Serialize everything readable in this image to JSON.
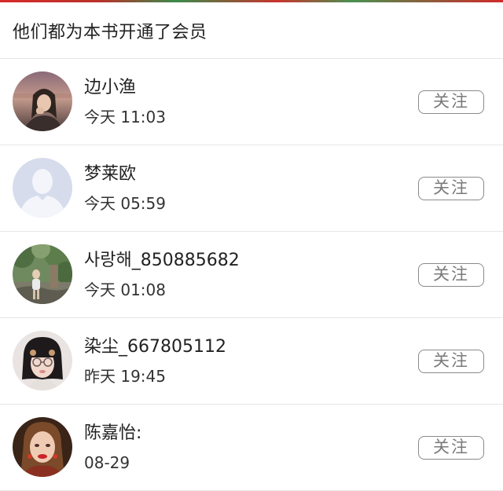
{
  "header": {
    "title": "他们都为本书开通了会员"
  },
  "members": [
    {
      "name": "边小渔",
      "time": "今天 11:03",
      "follow_label": "关注",
      "avatar_icon": "user-photo-avatar"
    },
    {
      "name": "梦莱欧",
      "time": "今天 05:59",
      "follow_label": "关注",
      "avatar_icon": "default-user-avatar"
    },
    {
      "name": "사랑해_850885682",
      "time": "今天 01:08",
      "follow_label": "关注",
      "avatar_icon": "user-photo-avatar"
    },
    {
      "name": "染尘_667805112",
      "time": "昨天 19:45",
      "follow_label": "关注",
      "avatar_icon": "user-photo-avatar"
    },
    {
      "name": "陈嘉怡:",
      "time": "08-29",
      "follow_label": "关注",
      "avatar_icon": "user-photo-avatar"
    }
  ],
  "colors": {
    "divider": "#e6e6e6",
    "button_border": "#8a8a8a",
    "button_text": "#7a7a7a",
    "default_avatar_bg": "#d6dcec"
  }
}
